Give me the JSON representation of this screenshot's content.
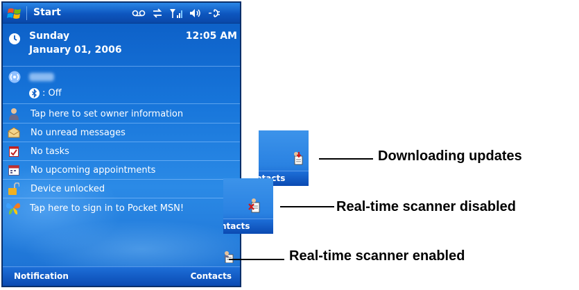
{
  "device": {
    "start_label": "Start",
    "status_icons": [
      "voicemail-icon",
      "sync-icon",
      "signal-icon",
      "speaker-icon",
      "power-icon"
    ],
    "day": "Sunday",
    "date": "January 01, 2006",
    "time": "12:05 AM",
    "bluetooth_status": ": Off",
    "items": [
      {
        "icon": "owner-icon",
        "label": "Tap here to set owner information"
      },
      {
        "icon": "messages-icon",
        "label": "No unread messages"
      },
      {
        "icon": "tasks-icon",
        "label": "No tasks"
      },
      {
        "icon": "calendar-icon",
        "label": "No upcoming appointments"
      },
      {
        "icon": "lock-icon",
        "label": "Device unlocked"
      },
      {
        "icon": "msn-butterfly-icon",
        "label": "Tap here to sign in to Pocket MSN!"
      }
    ],
    "softkey_left": "Notification",
    "softkey_right": "Contacts"
  },
  "tiles": {
    "downloading": {
      "text": "ntacts"
    },
    "disabled": {
      "text": "ntacts"
    }
  },
  "callouts": {
    "downloading": "Downloading updates",
    "disabled": "Real-time scanner disabled",
    "enabled": "Real-time scanner enabled"
  },
  "colors": {
    "screen_blue": "#1775da",
    "title_bar": "#0d56bf",
    "text": "#ffffff",
    "callout_text": "#000000"
  }
}
